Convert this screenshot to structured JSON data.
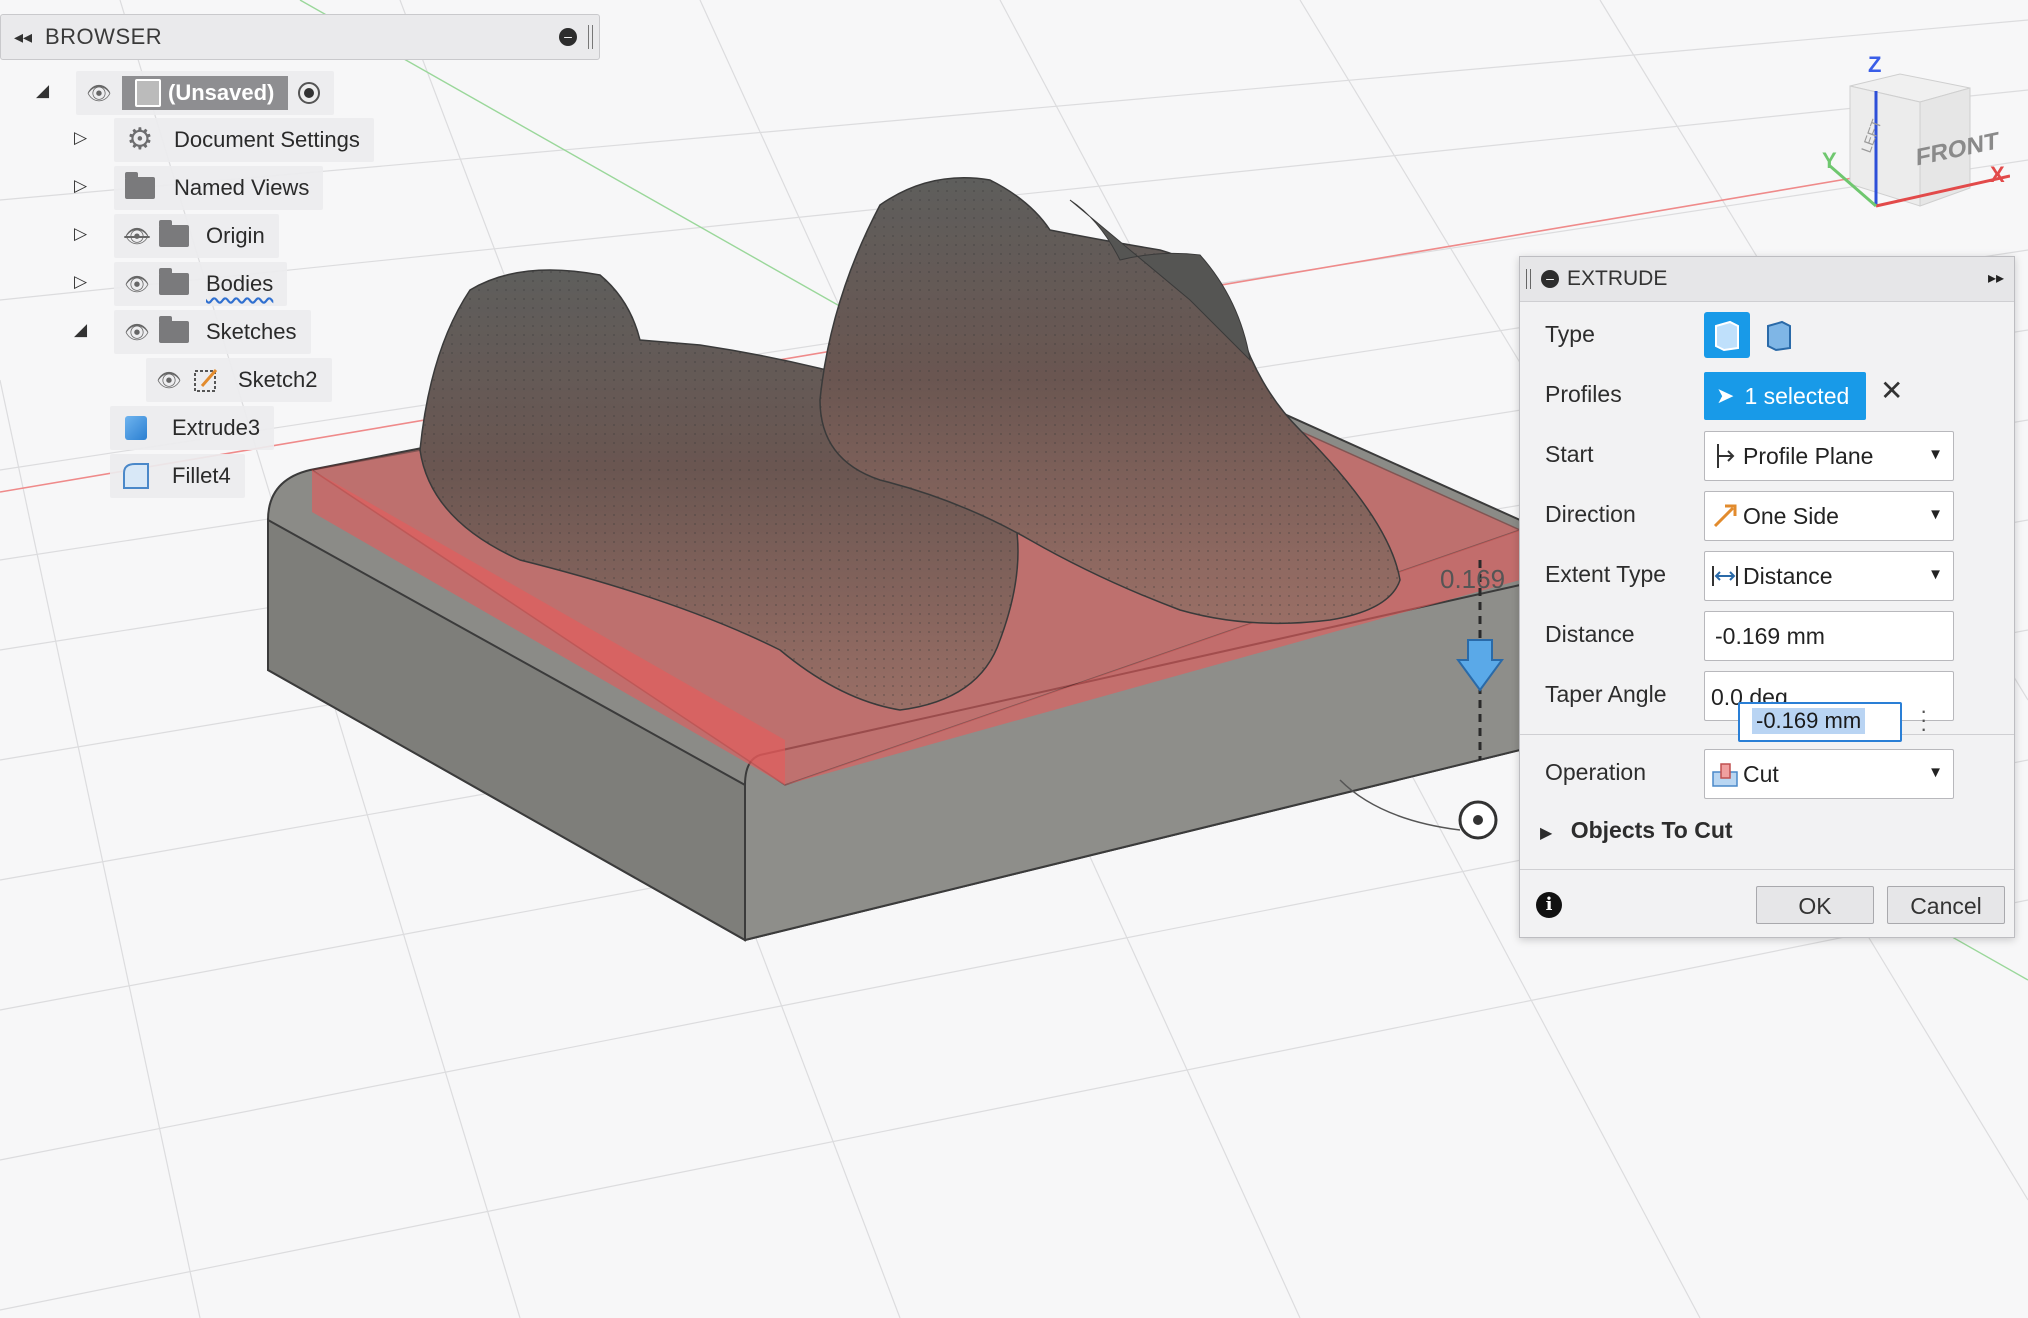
{
  "browser": {
    "title": "BROWSER",
    "items": [
      {
        "label": "(Unsaved)"
      },
      {
        "label": "Document Settings"
      },
      {
        "label": "Named Views"
      },
      {
        "label": "Origin"
      },
      {
        "label": "Bodies"
      },
      {
        "label": "Sketches"
      },
      {
        "label": "Sketch2"
      },
      {
        "label": "Extrude3"
      },
      {
        "label": "Fillet4"
      }
    ]
  },
  "viewcube": {
    "face_front": "FRONT",
    "face_left": "LEFT",
    "axis_z": "Z",
    "axis_x": "X",
    "axis_y": "Y"
  },
  "manipulator_label": "0.169",
  "extrude": {
    "title": "EXTRUDE",
    "type_label": "Type",
    "profiles_label": "Profiles",
    "profiles_value": "1 selected",
    "start_label": "Start",
    "start_value": "Profile Plane",
    "direction_label": "Direction",
    "direction_value": "One Side",
    "extent_label": "Extent Type",
    "extent_value": "Distance",
    "distance_label": "Distance",
    "distance_value": "-0.169 mm",
    "taper_label": "Taper Angle",
    "taper_value": "0.0 deg",
    "inline_input_value": "-0.169 mm",
    "operation_label": "Operation",
    "operation_value": "Cut",
    "objects_to_cut_label": "Objects To Cut",
    "ok_label": "OK",
    "cancel_label": "Cancel"
  },
  "colors": {
    "accent": "#189ae8",
    "cut_preview": "#e85a5a",
    "body_gray": "#8c8c88"
  }
}
